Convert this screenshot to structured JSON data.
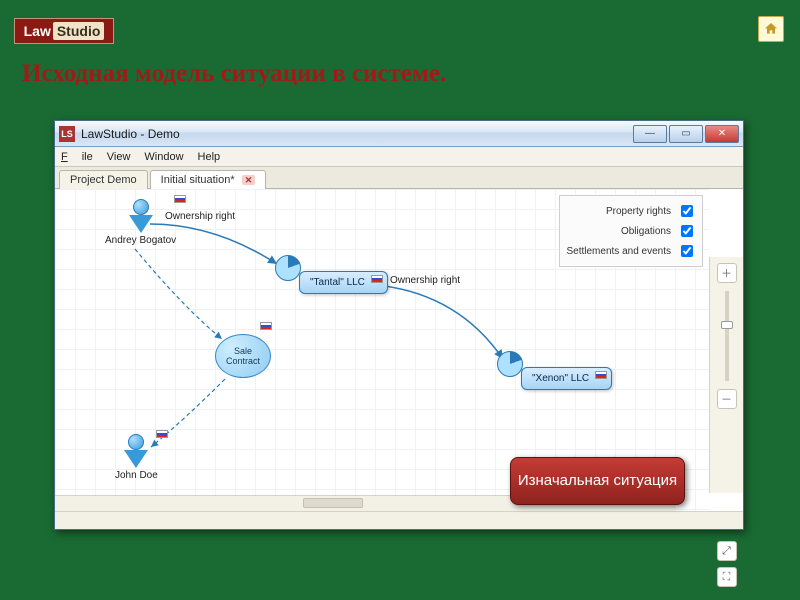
{
  "logo": {
    "left": "Law",
    "right": "Studio"
  },
  "slide_title": "Исходная  модель ситуации в системе.",
  "window": {
    "app_icon_text": "LS",
    "title": "LawStudio - Demo",
    "menu": {
      "file": "File",
      "view": "View",
      "window": "Window",
      "help": "Help"
    },
    "tabs": [
      {
        "label": "Project Demo",
        "active": false,
        "closable": false
      },
      {
        "label": "Initial situation*",
        "active": true,
        "closable": true
      }
    ],
    "legend": {
      "property_rights": {
        "label": "Property rights",
        "checked": true
      },
      "obligations": {
        "label": "Obligations",
        "checked": true
      },
      "settlements": {
        "label": "Settlements and events",
        "checked": true
      }
    },
    "actors": {
      "andrey": "Andrey Bogatov",
      "john": "John Doe"
    },
    "contract": "Sale Contract",
    "entities": {
      "tantal": "\"Tantal\" LLC",
      "xenon": "\"Xenon\" LLC"
    },
    "edges": {
      "ownership1": "Ownership right",
      "ownership2": "Ownership right"
    },
    "callout": "Изначальная ситуация"
  }
}
